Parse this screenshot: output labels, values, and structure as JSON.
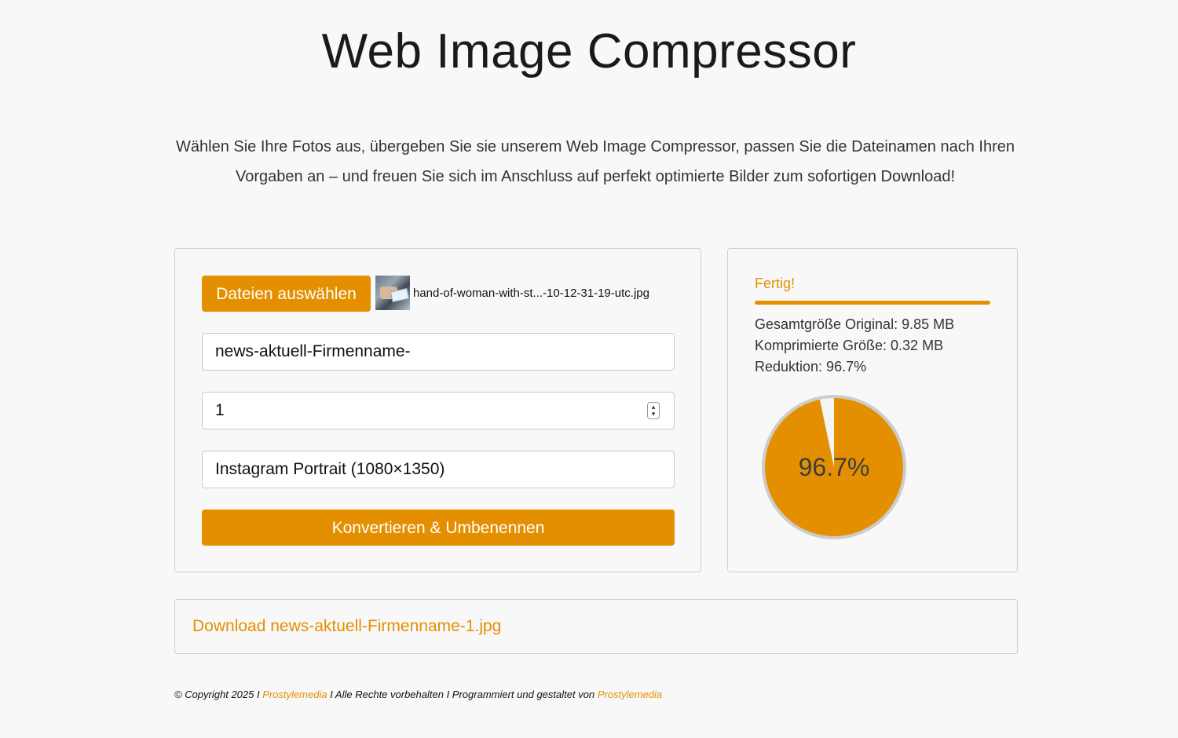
{
  "header": {
    "title": "Web Image Compressor",
    "intro": "Wählen Sie Ihre Fotos aus, übergeben Sie sie unserem Web Image Compressor, passen Sie die Dateinamen nach Ihren Vorgaben an – und freuen Sie sich im Anschluss auf perfekt optimierte Bilder zum sofortigen Download!"
  },
  "form": {
    "file_button_label": "Dateien auswählen",
    "selected_file_name": "hand-of-woman-with-st...-10-12-31-19-utc.jpg",
    "prefix_value": "news-aktuell-Firmenname-",
    "start_number_value": "1",
    "format_value": "Instagram Portrait (1080×1350)",
    "convert_button_label": "Konvertieren & Umbenennen"
  },
  "result": {
    "status": "Fertig!",
    "progress_percent": 100,
    "original_size": "Gesamtgröße Original: 9.85 MB",
    "compressed_size": "Komprimierte Größe: 0.32 MB",
    "reduction": "Reduktion: 96.7%",
    "pie_label": "96.7%",
    "reduction_value": 96.7
  },
  "download": {
    "link_text": "Download news-aktuell-Firmenname-1.jpg"
  },
  "footer": {
    "copyright": "© Copyright 2025 I ",
    "brand_1": "Prostylemedia",
    "rights": " I Alle Rechte vorbehalten I Programmiert und gestaltet von ",
    "brand_2": "Prostylemedia"
  },
  "colors": {
    "accent": "#e48f00",
    "pie_remainder": "#f4f4f4",
    "pie_border": "#cccccc"
  }
}
